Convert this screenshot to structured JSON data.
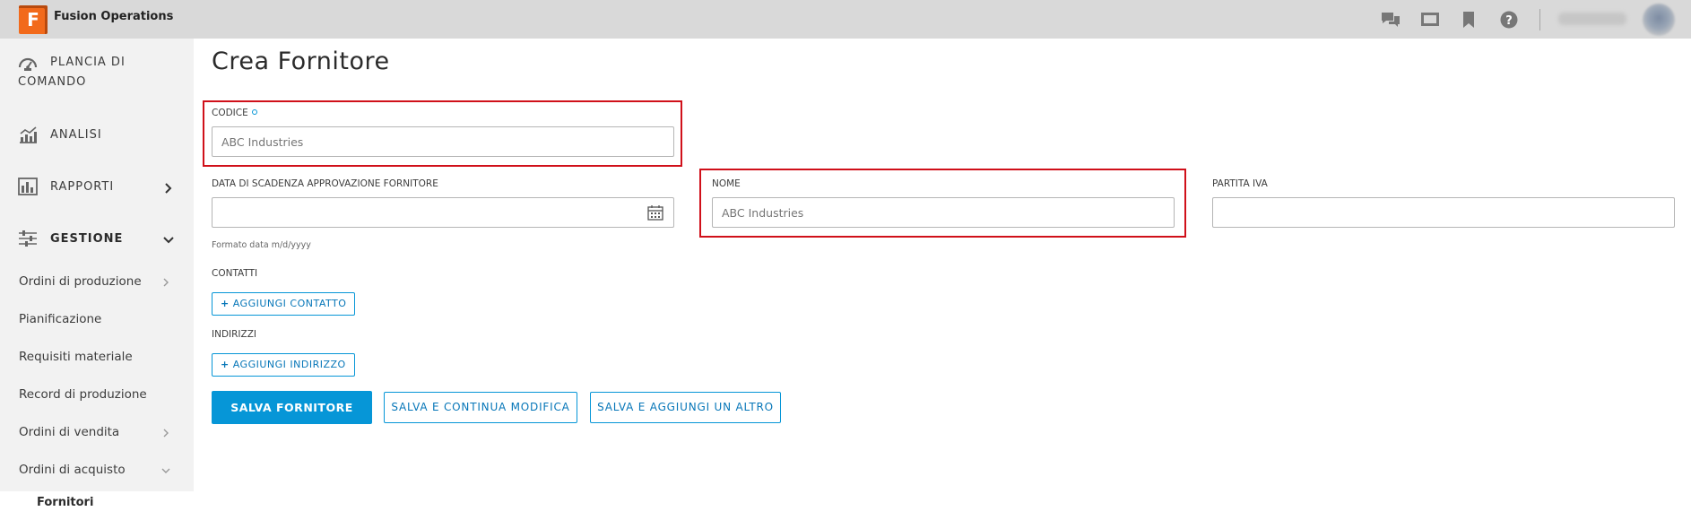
{
  "app": {
    "logo_letter": "F",
    "title": "Fusion Operations",
    "brand_color": "#f26a1b"
  },
  "topbar": {
    "icons": [
      "chat-icon",
      "monitor-icon",
      "bookmark-icon",
      "help-icon"
    ]
  },
  "sidebar": {
    "main_items": [
      {
        "label": "PLANCIA DI",
        "label2": "COMANDO",
        "icon": "dashboard-gauge-icon"
      },
      {
        "label": "ANALISI",
        "icon": "analytics-chart-icon"
      },
      {
        "label": "RAPPORTI",
        "icon": "reports-bar-icon"
      },
      {
        "label": "GESTIONE",
        "icon": "sliders-icon"
      }
    ],
    "sub_items": [
      {
        "label": "Ordini di produzione"
      },
      {
        "label": "Pianificazione"
      },
      {
        "label": "Requisiti materiale"
      },
      {
        "label": "Record di produzione"
      },
      {
        "label": "Ordini di vendita"
      },
      {
        "label": "Ordini di acquisto"
      }
    ],
    "active_child": "Fornitori"
  },
  "form": {
    "title": "Crea Fornitore",
    "codice": {
      "label": "CODICE",
      "placeholder": "ABC Industries"
    },
    "scadenza": {
      "label": "DATA DI SCADENZA APPROVAZIONE FORNITORE",
      "value": "",
      "hint": "Formato data m/d/yyyy"
    },
    "nome": {
      "label": "NOME",
      "placeholder": "ABC Industries"
    },
    "partita_iva": {
      "label": "PARTITA IVA",
      "value": ""
    },
    "contatti": {
      "label": "CONTATTI",
      "add_button": "AGGIUNGI CONTATTO"
    },
    "indirizzi": {
      "label": "INDIRIZZI",
      "add_button": "AGGIUNGI INDIRIZZO"
    },
    "actions": {
      "save": "SALVA FORNITORE",
      "save_continue": "SALVA E CONTINUA MODIFICA",
      "save_add": "SALVA E AGGIUNGI UN ALTRO"
    }
  },
  "colors": {
    "accent": "#0696d7",
    "highlight": "#d0101a"
  }
}
